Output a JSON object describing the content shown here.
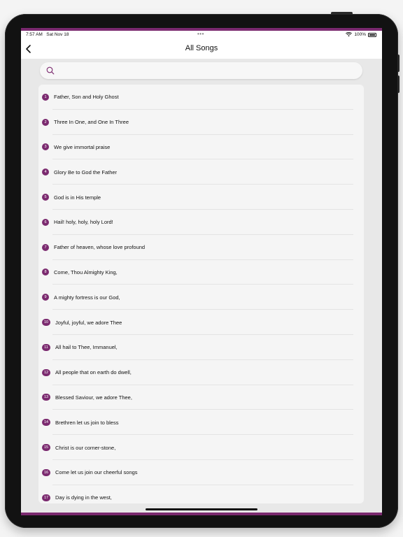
{
  "status": {
    "time": "7:57 AM",
    "date": "Sat Nov 18",
    "dots": "•••",
    "battery": "100%"
  },
  "nav": {
    "title": "All Songs"
  },
  "search": {
    "placeholder": "",
    "value": ""
  },
  "colors": {
    "accent": "#7b2a6f"
  },
  "songs": [
    {
      "num": "1",
      "title": "Father, Son and Holy Ghost"
    },
    {
      "num": "2",
      "title": "Three In One, and One In Three"
    },
    {
      "num": "3",
      "title": "We give immortal praise"
    },
    {
      "num": "4",
      "title": "Glory Be to God the Father"
    },
    {
      "num": "5",
      "title": "God is in His temple"
    },
    {
      "num": "6",
      "title": "Hail! holy, holy, holy Lord!"
    },
    {
      "num": "7",
      "title": "Father of heaven, whose love profound"
    },
    {
      "num": "8",
      "title": "Come, Thou Almighty King,"
    },
    {
      "num": "9",
      "title": "A mighty fortress is our God,"
    },
    {
      "num": "10",
      "title": "Joyful, joyful, we adore Thee"
    },
    {
      "num": "11",
      "title": "All hail to Thee, Immanuel,"
    },
    {
      "num": "12",
      "title": "All people that on earth do dwell,"
    },
    {
      "num": "13",
      "title": "Blessed Saviour, we adore Thee,"
    },
    {
      "num": "14",
      "title": "Brethren let us join to bless"
    },
    {
      "num": "15",
      "title": "Christ is our corner-stone,"
    },
    {
      "num": "16",
      "title": "Come let us join our cheerful songs"
    },
    {
      "num": "17",
      "title": "Day is dying in the west,"
    }
  ]
}
